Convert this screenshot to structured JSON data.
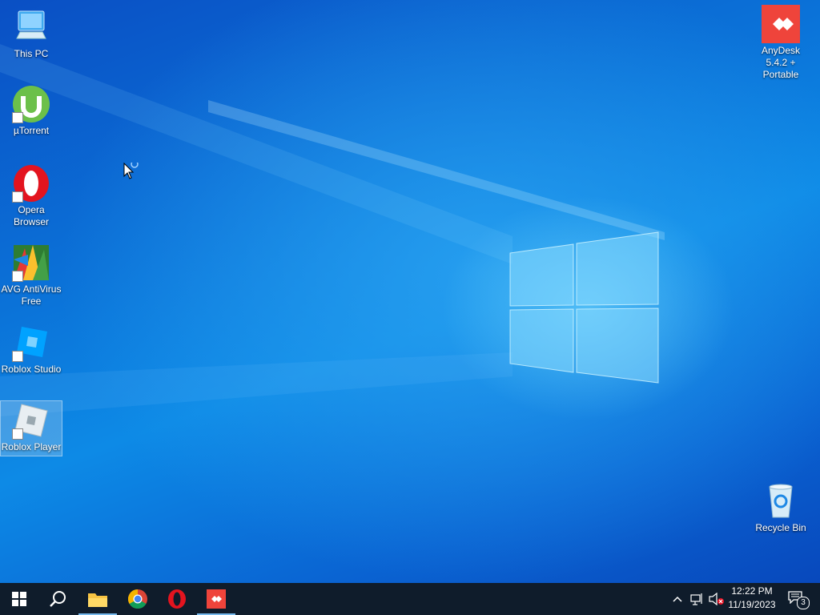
{
  "desktop": {
    "icons": [
      {
        "label": "This PC",
        "icon": "this-pc-icon"
      },
      {
        "label": "µTorrent",
        "icon": "utorrent-icon"
      },
      {
        "label": "Opera Browser",
        "icon": "opera-icon"
      },
      {
        "label": "AVG AntiVirus Free",
        "icon": "avg-icon"
      },
      {
        "label": "Roblox Studio",
        "icon": "roblox-studio-icon"
      },
      {
        "label": "Roblox Player",
        "icon": "roblox-player-icon"
      },
      {
        "label": "AnyDesk 5.4.2 + Portable",
        "icon": "anydesk-icon"
      },
      {
        "label": "Recycle Bin",
        "icon": "recycle-bin-icon"
      }
    ],
    "selected_icon": "Roblox Player"
  },
  "taskbar": {
    "pinned": [
      {
        "name": "start",
        "icon": "windows-logo-icon"
      },
      {
        "name": "search",
        "icon": "search-icon"
      },
      {
        "name": "file-explorer",
        "icon": "folder-icon"
      },
      {
        "name": "chrome",
        "icon": "chrome-icon"
      },
      {
        "name": "opera",
        "icon": "opera-icon"
      },
      {
        "name": "anydesk",
        "icon": "anydesk-icon"
      }
    ],
    "tray": {
      "time": "12:22 PM",
      "date": "11/19/2023",
      "notification_count": "3"
    }
  },
  "colors": {
    "taskbar_bg": "#0f1c2b",
    "accent": "#76b9ed",
    "anydesk_red": "#ef443b",
    "opera_red": "#e3141f"
  }
}
